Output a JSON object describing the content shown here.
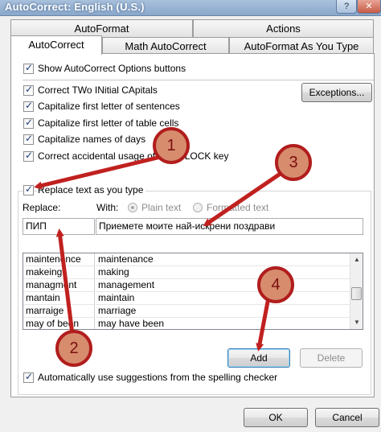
{
  "window": {
    "title": "AutoCorrect: English (U.S.)",
    "help_glyph": "?",
    "close_glyph": "✕"
  },
  "tabs": {
    "top_row": [
      "AutoFormat",
      "Actions"
    ],
    "bottom_row": [
      "AutoCorrect",
      "Math AutoCorrect",
      "AutoFormat As You Type"
    ],
    "active": "AutoCorrect"
  },
  "options": {
    "show_buttons": "Show AutoCorrect Options buttons",
    "correct_two_initial": "Correct TWo INitial CApitals",
    "capitalize_sentences": "Capitalize first letter of sentences",
    "capitalize_table_cells": "Capitalize first letter of table cells",
    "capitalize_days": "Capitalize names of days",
    "correct_caps_lock": "Correct accidental usage of cAPS LOCK key",
    "replace_text": "Replace text as you type",
    "auto_suggestions": "Automatically use suggestions from the spelling checker"
  },
  "buttons": {
    "exceptions": "Exceptions...",
    "add": "Add",
    "delete": "Delete",
    "ok": "OK",
    "cancel": "Cancel"
  },
  "replace": {
    "replace_label": "Replace:",
    "with_label": "With:",
    "plain_text": "Plain text",
    "formatted_text": "Formatted text",
    "replace_value": "ПИП",
    "with_value": "Приемете моите най-искрени поздрави"
  },
  "entries": [
    {
      "from": "maintenence",
      "to": "maintenance"
    },
    {
      "from": "makeing",
      "to": "making"
    },
    {
      "from": "managment",
      "to": "management"
    },
    {
      "from": "mantain",
      "to": "maintain"
    },
    {
      "from": "marraige",
      "to": "marriage"
    },
    {
      "from": "may of been",
      "to": "may have been"
    }
  ],
  "annotations": {
    "step1": "1",
    "step2": "2",
    "step3": "3",
    "step4": "4",
    "arrow_color": "#c0211f",
    "badge_fill": "#d78c6e"
  }
}
